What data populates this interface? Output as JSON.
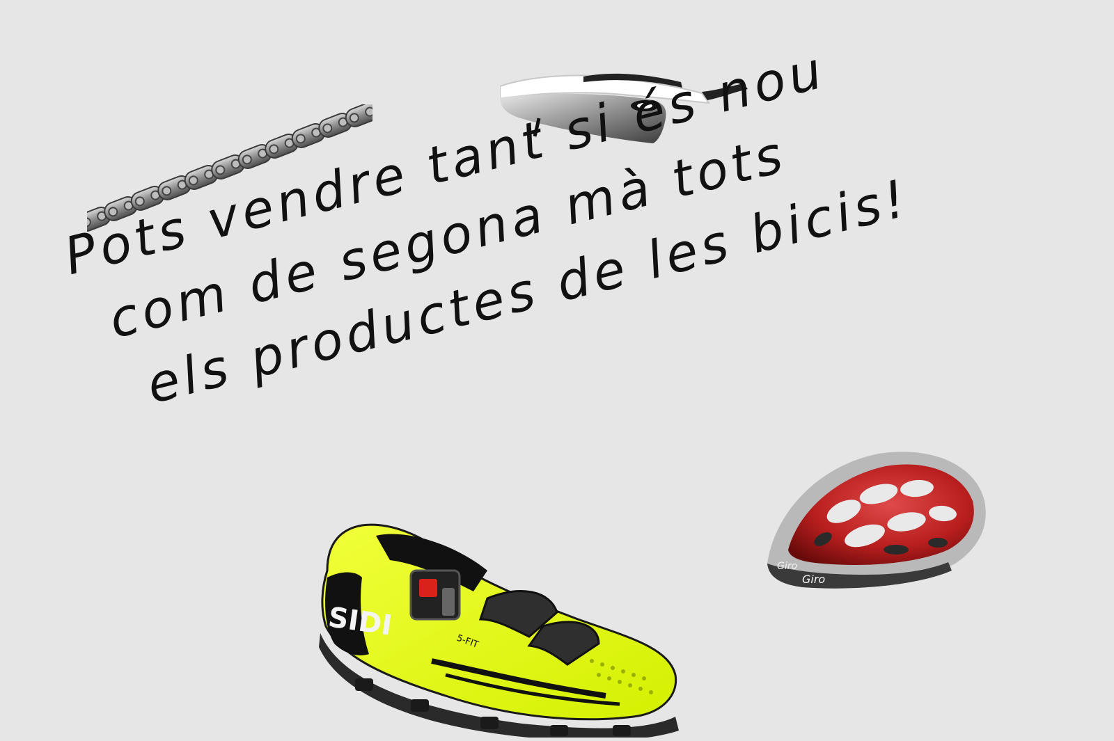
{
  "background_color": "#e6e6e6",
  "text_color": "#111111",
  "message": {
    "line_1": "Pots vendre tant si és nou",
    "line_2": "com de segona mà tots",
    "line_3": "els productes de les bicis!"
  },
  "products": [
    {
      "icon": "bike-chain-icon"
    },
    {
      "icon": "sport-sunglasses-icon"
    },
    {
      "icon": "cycling-helmet-icon",
      "brand": "Giro"
    },
    {
      "icon": "cycling-shoe-icon",
      "brand": "SIDI",
      "model": "5-FIT"
    }
  ],
  "colors": {
    "shoe_yellow": "#e5ff1a",
    "helmet_red": "#b81e1e",
    "chain_gray": "#8b8b8b"
  }
}
